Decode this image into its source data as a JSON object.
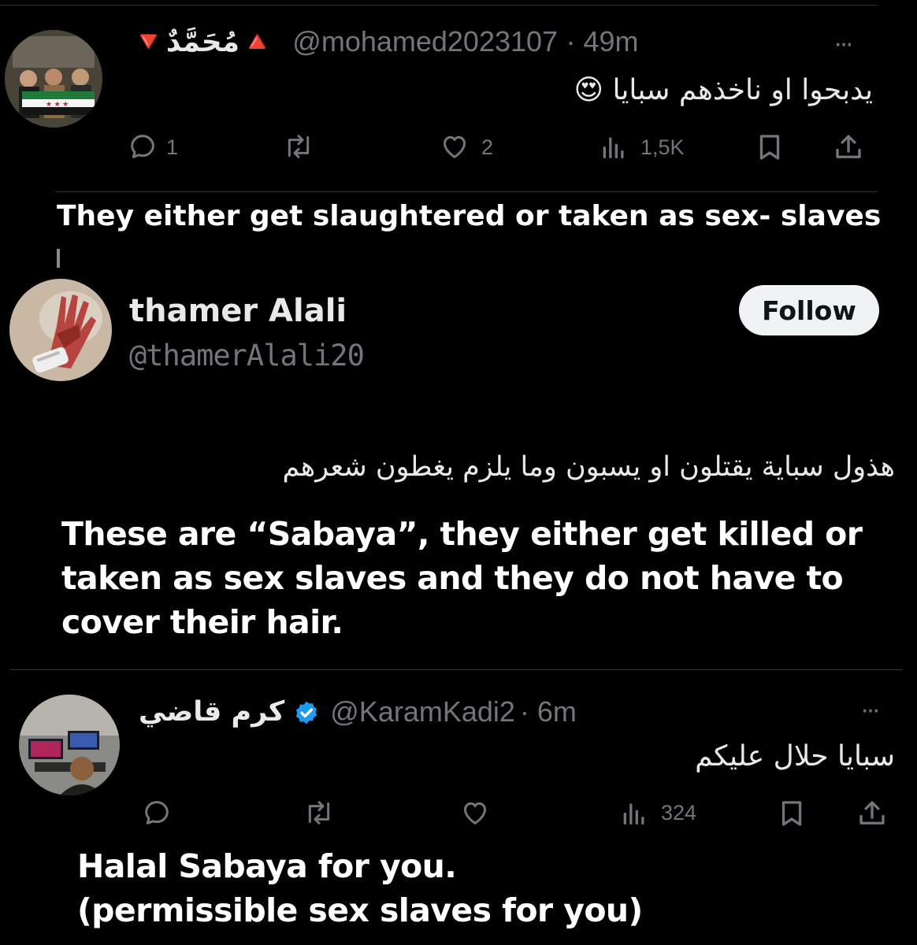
{
  "tweet1": {
    "display_name": "🔻مُحَمَّدٌ🔺",
    "handle": "@mohamed2023107",
    "time": "· 49m",
    "text": "يدبحوا او ناخذهم سبايا 😍",
    "replies": "1",
    "likes": "2",
    "views": "1,5K",
    "more": "···"
  },
  "caption1": "They either get slaughtered or taken as sex- slaves",
  "profile": {
    "name": "thamer Alali",
    "handle": "@thamerAlali20",
    "follow_label": "Follow",
    "arabic_text": "هذول سباية يقتلون او يسبون وما يلزم يغطون شعرهم"
  },
  "caption2": {
    "line1": "These are “Sabaya”, they either get killed or",
    "line2": "taken as sex slaves and they do not have to",
    "line3": "cover their hair."
  },
  "tweet2": {
    "display_name": "كرم قاضي",
    "handle": "@KaramKadi2",
    "time": "· 6m",
    "text": "سبايا حلال عليكم",
    "views": "324",
    "more": "···"
  },
  "caption3": {
    "line1": "Halal Sabaya for you.",
    "line2": "(permissible sex slaves for you)"
  },
  "colors": {
    "background": "#000000",
    "text": "#e7e9ea",
    "muted": "#71767b",
    "verified": "#1d9bf0",
    "follow_bg": "#eff3f4"
  },
  "icons": [
    "reply-icon",
    "retweet-icon",
    "like-icon",
    "views-icon",
    "bookmark-icon",
    "share-icon",
    "more-icon",
    "verified-badge-icon"
  ]
}
